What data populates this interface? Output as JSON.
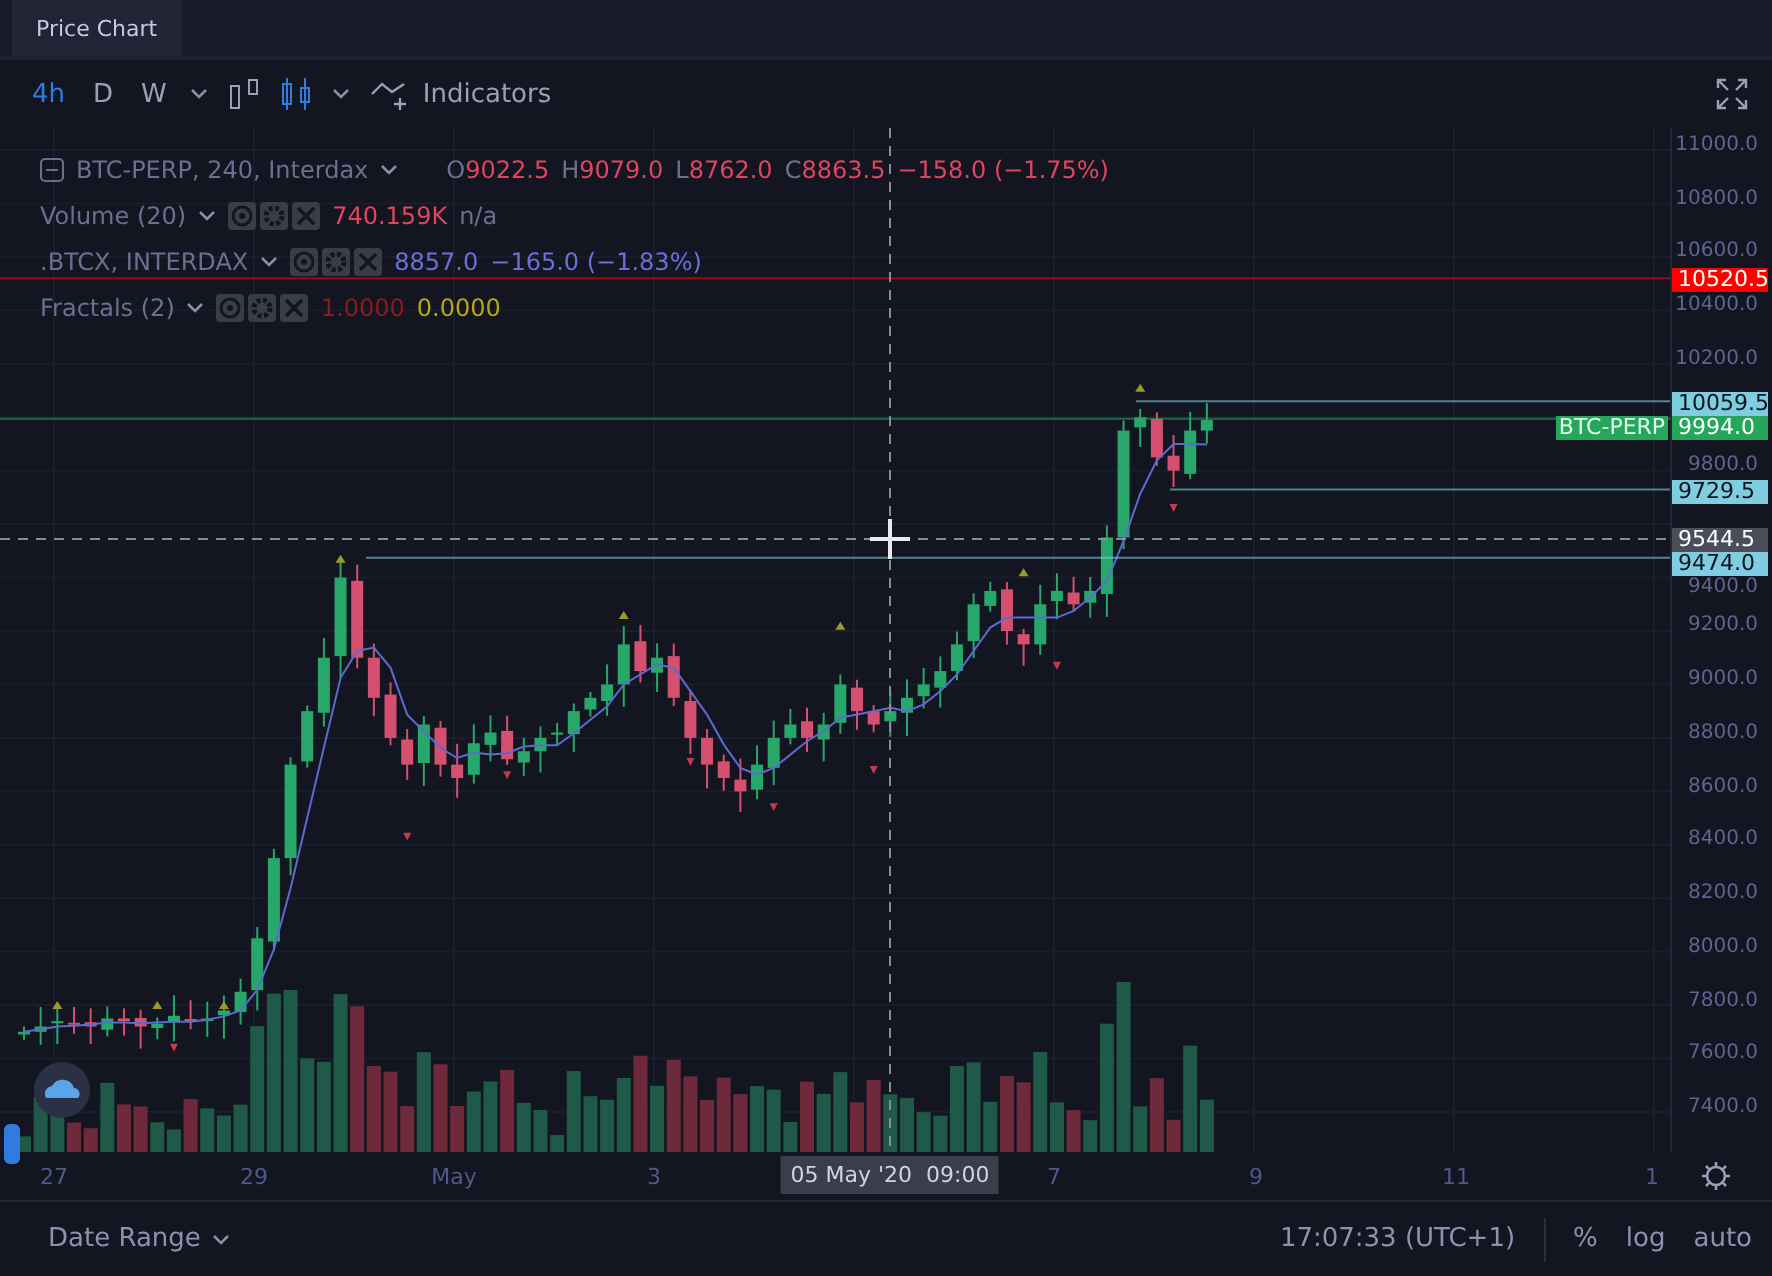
{
  "tabs": [
    {
      "label": "Price Chart",
      "selected": true
    }
  ],
  "toolbar": {
    "intervals": [
      {
        "label": "4h",
        "selected": true
      },
      {
        "label": "D",
        "selected": false
      },
      {
        "label": "W",
        "selected": false
      }
    ],
    "chart_types": [
      {
        "kind": "bars",
        "selected": false
      },
      {
        "kind": "candles",
        "selected": true
      }
    ],
    "indicators_label": "Indicators"
  },
  "legend": {
    "symbol": "BTC-PERP, 240, Interdax",
    "ohlc": [
      {
        "label": "O",
        "value": "9022.5"
      },
      {
        "label": "H",
        "value": "9079.0"
      },
      {
        "label": "L",
        "value": "8762.0"
      },
      {
        "label": "C",
        "value": "8863.5"
      }
    ],
    "change": "−158.0 (−1.75%)",
    "studies": [
      {
        "name": "Volume (20)",
        "values": [
          {
            "text": "740.159K",
            "color": "#e0455e"
          },
          {
            "text": "n/a",
            "color": "#6a7090"
          }
        ]
      },
      {
        "name": ".BTCX, INTERDAX",
        "values": [
          {
            "text": "8857.0",
            "color": "#6b70d8"
          },
          {
            "text": "−165.0 (−1.83%)",
            "color": "#6b70d8"
          }
        ]
      },
      {
        "name": "Fractals (2)",
        "values": [
          {
            "text": "1.0000",
            "color": "#8b1c1c"
          },
          {
            "text": "0.0000",
            "color": "#b8a614"
          }
        ]
      }
    ]
  },
  "price_axis": {
    "labels": [
      "11000.0",
      "10800.0",
      "10600.0",
      "10400.0",
      "10200.0",
      "9800.0",
      "9400.0",
      "9200.0",
      "9000.0",
      "8800.0",
      "8600.0",
      "8400.0",
      "8200.0",
      "8000.0",
      "7800.0",
      "7600.0",
      "7400.0"
    ],
    "markers": [
      {
        "text": "10520.5",
        "color": "#ff0000"
      },
      {
        "text": "10059.5",
        "color": "#7fcde0"
      },
      {
        "name": "BTC-PERP",
        "text": "9994.0",
        "color": "#26a65b"
      },
      {
        "text": "9729.5",
        "color": "#7fcde0"
      },
      {
        "text": "9544.5",
        "color": "#4b4e58"
      },
      {
        "text": "9474.0",
        "color": "#7fcde0"
      }
    ]
  },
  "time_axis": {
    "labels": [
      "27",
      "29",
      "May",
      "3",
      "7",
      "9",
      "11",
      "1"
    ],
    "crosshair_label": "05 May '20  09:00"
  },
  "bottom_bar": {
    "date_range": "Date Range",
    "clock": "17:07:33 (UTC+1)",
    "buttons": [
      "%",
      "log",
      "auto"
    ]
  }
}
